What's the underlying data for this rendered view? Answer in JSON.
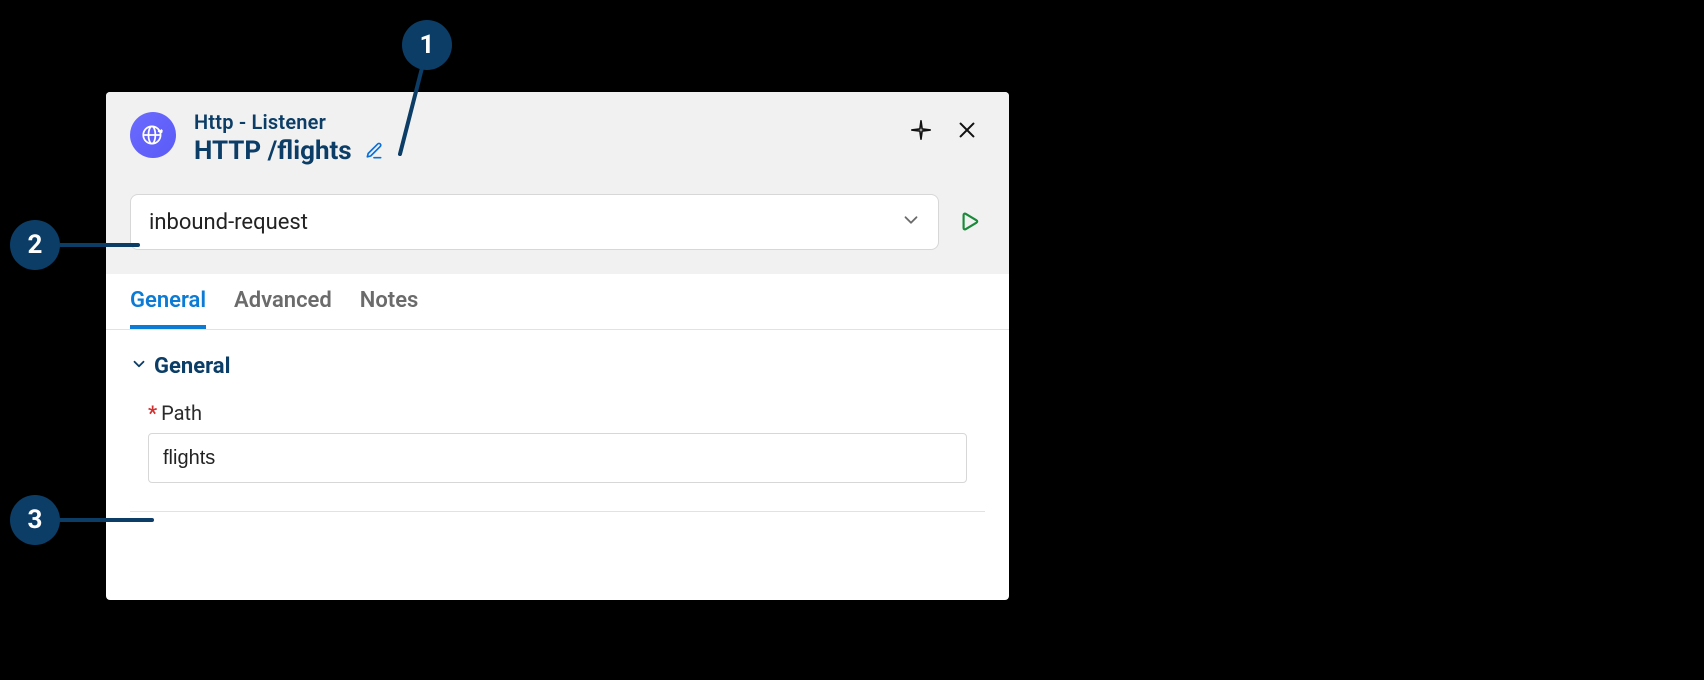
{
  "callouts": {
    "c1": "1",
    "c2": "2",
    "c3": "3"
  },
  "header": {
    "component_type": "Http - Listener",
    "title": "HTTP /flights"
  },
  "dropdown": {
    "value": "inbound-request"
  },
  "tabs": [
    {
      "id": "general",
      "label": "General",
      "active": true
    },
    {
      "id": "advanced",
      "label": "Advanced",
      "active": false
    },
    {
      "id": "notes",
      "label": "Notes",
      "active": false
    }
  ],
  "section": {
    "title": "General",
    "fields": {
      "path": {
        "label": "Path",
        "required": true,
        "value": "flights"
      }
    }
  }
}
